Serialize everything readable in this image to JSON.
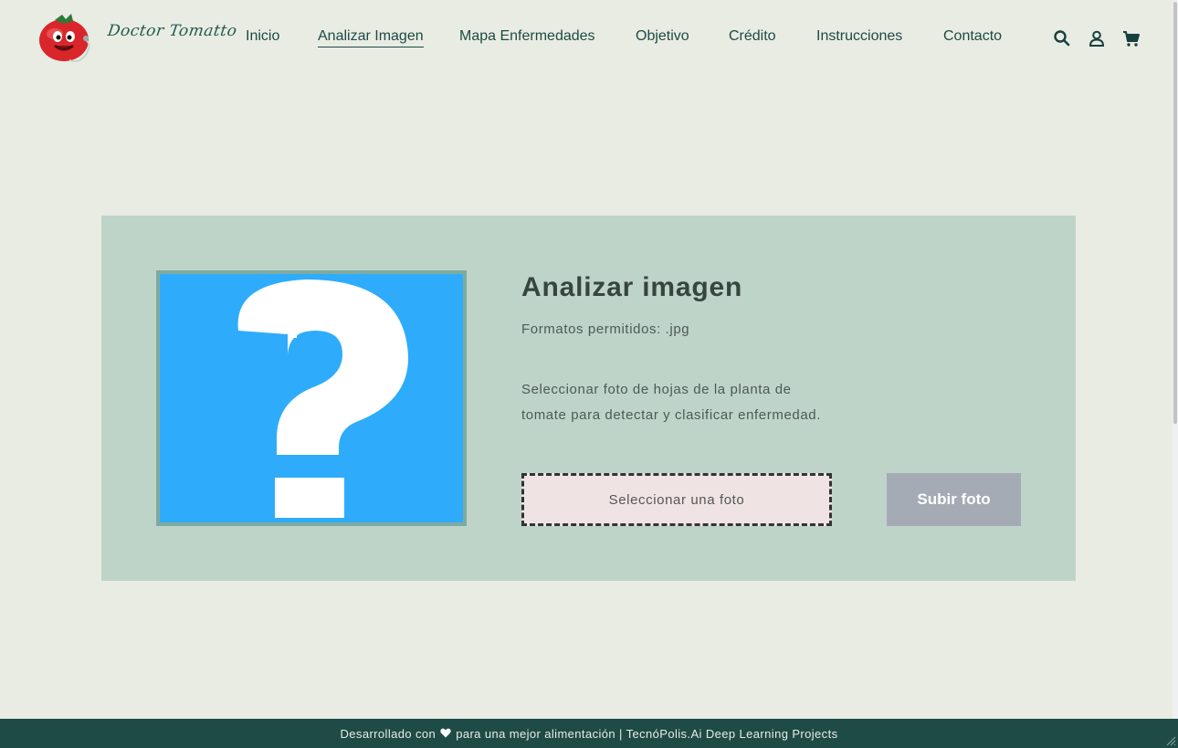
{
  "header": {
    "brand": "Doctor Tomatto",
    "nav": [
      {
        "label": "Inicio",
        "active": false
      },
      {
        "label": "Analizar Imagen",
        "active": true
      },
      {
        "label": "Mapa Enfermedades",
        "active": false
      },
      {
        "label": "Objetivo",
        "active": false
      },
      {
        "label": "Crédito",
        "active": false
      },
      {
        "label": "Instrucciones",
        "active": false
      },
      {
        "label": "Contacto",
        "active": false
      }
    ],
    "icons": [
      "search-icon",
      "user-icon",
      "cart-icon"
    ]
  },
  "main": {
    "title": "Analizar imagen",
    "formats": "Formatos permitidos: .jpg",
    "description": "Seleccionar foto de hojas de la planta de tomate para detectar y clasificar enfermedad.",
    "file_select_label": "Seleccionar una foto",
    "upload_label": "Subir foto",
    "preview_icon": "question-mark-icon"
  },
  "footer": {
    "prefix": "Desarrollado con",
    "suffix": "para una mejor alimentación | TecnóPolis.Ai Deep Learning Projects"
  },
  "colors": {
    "background": "#e9ece3",
    "card": "#bfd4c9",
    "preview": "#2eacfb",
    "footer": "#1f4b47",
    "upload_button": "#a4abb5",
    "file_select": "#efe4e3"
  }
}
